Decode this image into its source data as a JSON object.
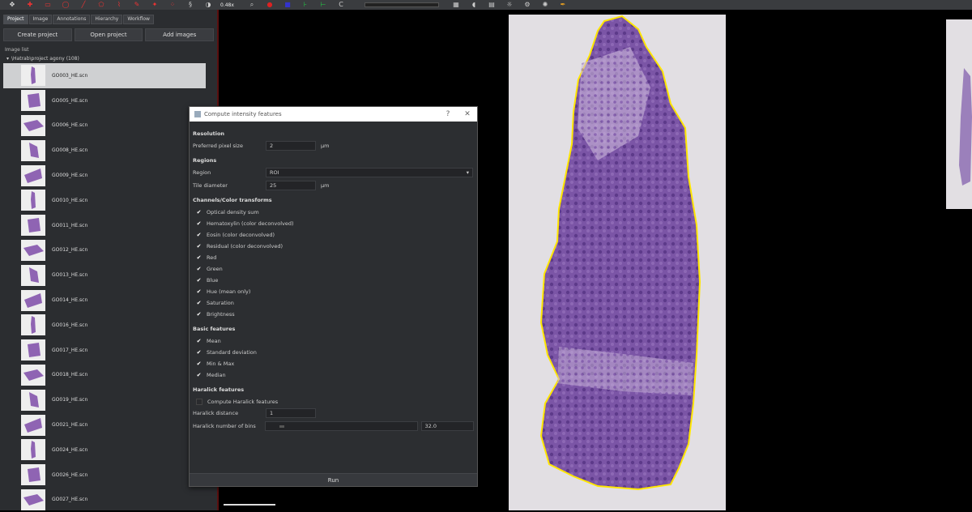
{
  "toolbar": {
    "zoom": "0.48x",
    "icons": [
      "move-icon",
      "plus-icon",
      "rectangle-icon",
      "ellipse-icon",
      "line-icon",
      "polygon-icon",
      "polyline-icon",
      "brush-icon",
      "wand-icon",
      "points-icon",
      "settings-icon",
      "contrast-icon",
      "zoom-icon",
      "record-icon",
      "grid-icon",
      "annotation-icon",
      "detection-icon",
      "refresh-icon",
      "measure-icon",
      "cell-icon",
      "table-icon",
      "light-icon",
      "script-icon"
    ]
  },
  "left_panel": {
    "tabs": [
      "Project",
      "Image",
      "Annotations",
      "Hierarchy",
      "Workflow"
    ],
    "buttons": [
      "Create project",
      "Open project",
      "Add images"
    ],
    "image_list_label": "Image list",
    "tree_root": "\\Hatrab\\project agony (108)",
    "images": [
      "GO003_HE.scn",
      "GO005_HE.scn",
      "GO006_HE.scn",
      "GO008_HE.scn",
      "GO009_HE.scn",
      "GO010_HE.scn",
      "GO011_HE.scn",
      "GO012_HE.scn",
      "GO013_HE.scn",
      "GO014_HE.scn",
      "GO016_HE.scn",
      "GO017_HE.scn",
      "GO018_HE.scn",
      "GO019_HE.scn",
      "GO021_HE.scn",
      "GO024_HE.scn",
      "GO026_HE.scn",
      "GO027_HE.scn"
    ],
    "selected_index": 0
  },
  "dialog": {
    "title": "Compute intensity features",
    "resolution_heading": "Resolution",
    "pixel_size_label": "Preferred pixel size",
    "pixel_size_value": "2",
    "pixel_size_unit": "µm",
    "regions_heading": "Regions",
    "region_label": "Region",
    "region_value": "ROI",
    "tile_label": "Tile diameter",
    "tile_value": "25",
    "tile_unit": "µm",
    "channels_heading": "Channels/Color transforms",
    "channels": [
      {
        "label": "Optical density sum",
        "checked": true
      },
      {
        "label": "Hematoxylin (color deconvolved)",
        "checked": true
      },
      {
        "label": "Eosin (color deconvolved)",
        "checked": true
      },
      {
        "label": "Residual (color deconvolved)",
        "checked": true
      },
      {
        "label": "Red",
        "checked": true
      },
      {
        "label": "Green",
        "checked": true
      },
      {
        "label": "Blue",
        "checked": true
      },
      {
        "label": "Hue (mean only)",
        "checked": true
      },
      {
        "label": "Saturation",
        "checked": true
      },
      {
        "label": "Brightness",
        "checked": true
      }
    ],
    "basic_heading": "Basic features",
    "basic": [
      {
        "label": "Mean",
        "checked": true
      },
      {
        "label": "Standard deviation",
        "checked": true
      },
      {
        "label": "Min & Max",
        "checked": true
      },
      {
        "label": "Median",
        "checked": true
      }
    ],
    "haralick_heading": "Haralick features",
    "haralick_compute": {
      "label": "Compute Haralick features",
      "checked": false
    },
    "haralick_distance_label": "Haralick distance",
    "haralick_distance_value": "1",
    "haralick_bins_label": "Haralick number of bins",
    "haralick_bins_value": "32.0",
    "haralick_bins_level": 0.09,
    "run_label": "Run"
  },
  "colors": {
    "annotation_outline": "#ffe600",
    "tissue": "#7a4a9e",
    "panel_border": "#5a1010"
  }
}
